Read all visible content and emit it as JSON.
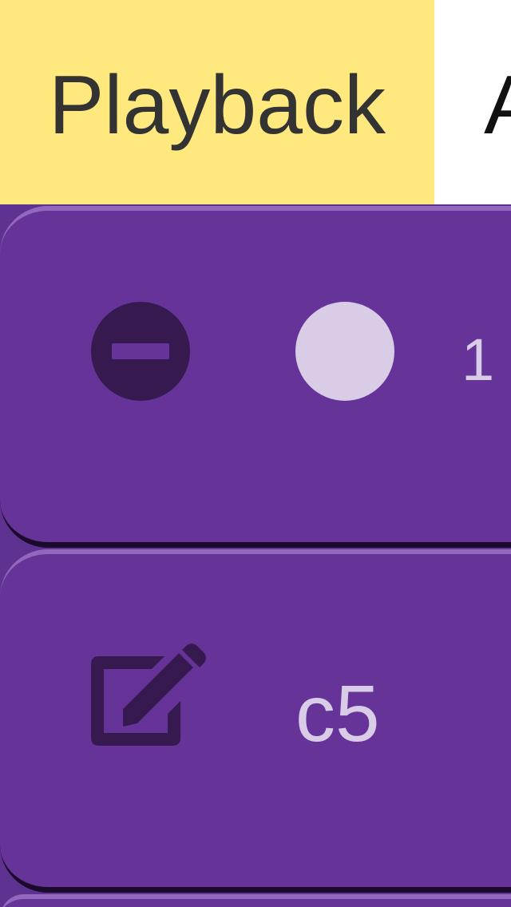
{
  "tabs": [
    {
      "label": "Playback",
      "selected": true
    },
    {
      "label": "A",
      "selected": false
    }
  ],
  "rows": [
    {
      "action_icon": "remove-circle-icon",
      "indicator_icon": "radio-dot-icon",
      "value": "1"
    },
    {
      "action_icon": "edit-icon",
      "value": "c5"
    }
  ],
  "colors": {
    "tab_selected_bg": "#ffe97f",
    "card_bg": "#663399",
    "icon_dark": "#361a4f",
    "text_light": "#d8cce6"
  }
}
